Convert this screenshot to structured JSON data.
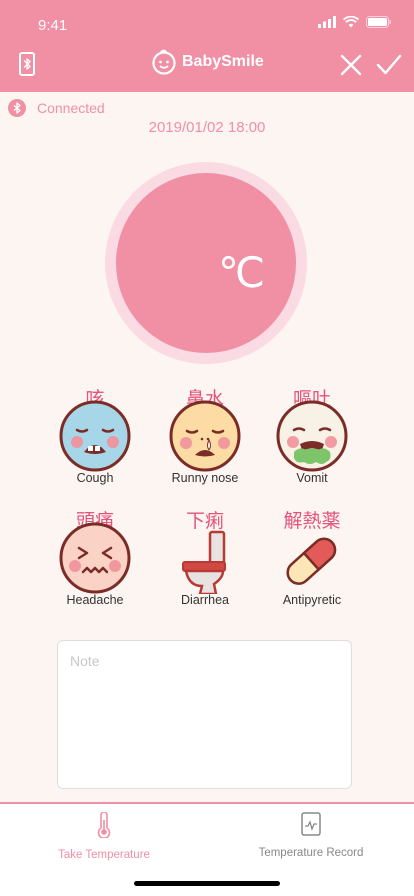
{
  "status": {
    "time": "9:41"
  },
  "nav": {
    "brand": "BabySmile"
  },
  "connection": {
    "text": "Connected"
  },
  "datetime": "2019/01/02 18:00",
  "temperature": {
    "value": "",
    "unit": "℃"
  },
  "symptoms": [
    {
      "cjk": "咳",
      "label": "Cough",
      "icon": "cough-face-icon"
    },
    {
      "cjk": "鼻水",
      "label": "Runny nose",
      "icon": "runny-nose-face-icon"
    },
    {
      "cjk": "嘔吐",
      "label": "Vomit",
      "icon": "vomit-face-icon"
    },
    {
      "cjk": "頭痛",
      "label": "Headache",
      "icon": "headache-face-icon"
    },
    {
      "cjk": "下痢",
      "label": "Diarrhea",
      "icon": "toilet-icon"
    },
    {
      "cjk": "解熱薬",
      "label": "Antipyretic",
      "icon": "pill-icon"
    }
  ],
  "note": {
    "placeholder": "Note"
  },
  "tabs": [
    {
      "label": "Take Temperature",
      "icon": "thermometer-icon",
      "active": true
    },
    {
      "label": "Temperature Record",
      "icon": "chart-record-icon",
      "active": false
    }
  ],
  "colors": {
    "primary": "#f18fa5",
    "accent": "#e4547a",
    "background": "#fdf5f2",
    "tab_inactive": "#888888"
  }
}
